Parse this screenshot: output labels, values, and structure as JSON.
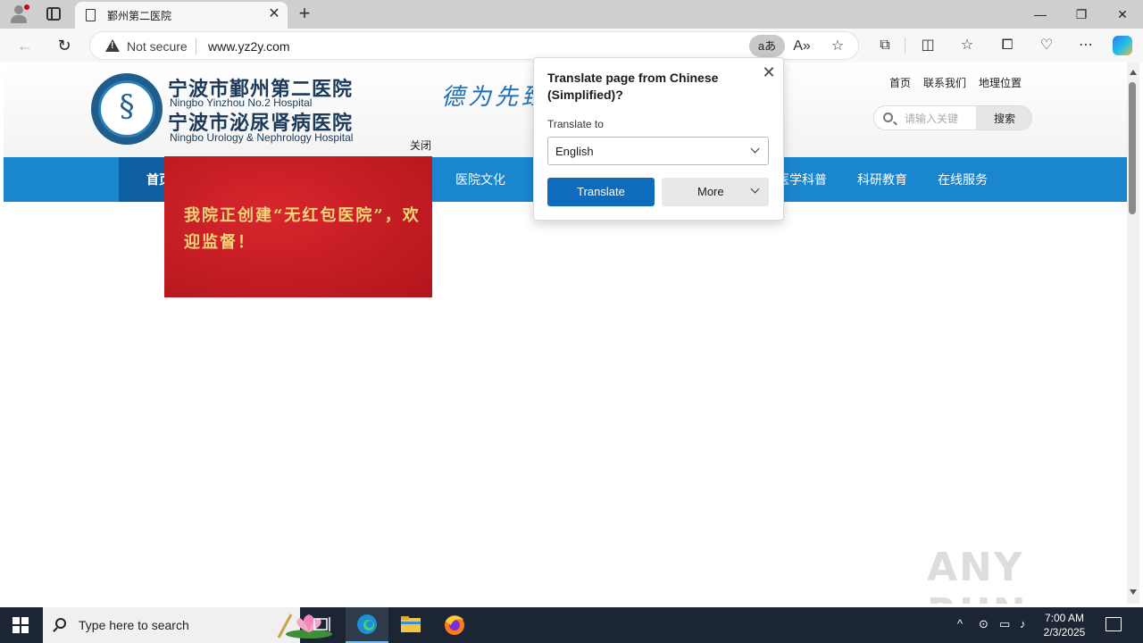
{
  "browser": {
    "tab_title": "鄞州第二医院",
    "security_label": "Not secure",
    "url": "www.yz2y.com",
    "translate_pill": "aあ"
  },
  "site": {
    "name_cn_1": "宁波市鄞州第二医院",
    "name_en_1": "Ningbo Yinzhou No.2 Hospital",
    "name_cn_2": "宁波市泌尿肾病医院",
    "name_en_2": "Ningbo Urology & Nephrology Hospital",
    "motto": "德为先臻",
    "top_links": [
      "首页",
      "联系我们",
      "地理位置"
    ],
    "search_placeholder": "请输入关键",
    "search_button": "搜索",
    "popup_close": "关闭",
    "nav": {
      "home": "首页",
      "items": [
        "医院文化",
        "医学科普",
        "科研教育",
        "在线服务"
      ]
    },
    "promo_text": "我院正创建“无红包医院”，欢迎监督！"
  },
  "translate": {
    "heading": "Translate page from Chinese (Simplified)?",
    "to_label": "Translate to",
    "language": "English",
    "translate_button": "Translate",
    "more_button": "More"
  },
  "taskbar": {
    "search_placeholder": "Type here to search",
    "time": "7:00 AM",
    "date": "2/3/2025"
  },
  "watermark": "ANY RUN",
  "colors": {
    "nav_blue": "#1a86d0",
    "nav_active": "#0f5fa3",
    "translate_primary": "#0f6cbd",
    "promo_red": "#c81e25"
  }
}
